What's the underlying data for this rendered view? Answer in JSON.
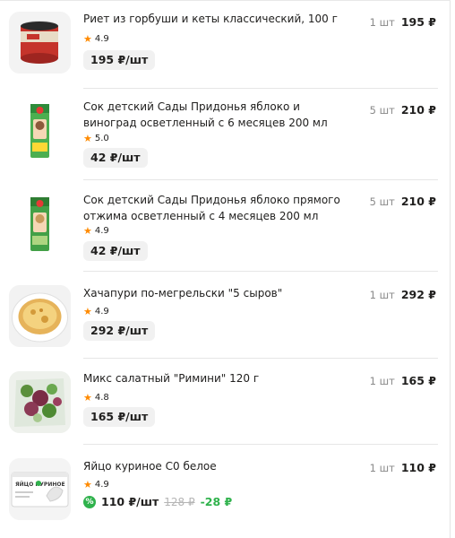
{
  "items": [
    {
      "title": "Риет из горбуши и кеты классический, 100 г",
      "rating": "4.9",
      "unit_price": "195 ₽/шт",
      "qty": "1 шт",
      "total": "195 ₽",
      "image_icon": "fish-rillette-jar"
    },
    {
      "title": "Сок детский Сады Придонья яблоко и виноград осветленный с 6 месяцев 200 мл",
      "rating": "5.0",
      "unit_price": "42 ₽/шт",
      "qty": "5 шт",
      "total": "210 ₽",
      "image_icon": "juice-box"
    },
    {
      "title": "Сок детский Сады Придонья яблоко прямого отжима осветленный с 4 месяцев 200 мл",
      "rating": "4.9",
      "unit_price": "42 ₽/шт",
      "qty": "5 шт",
      "total": "210 ₽",
      "image_icon": "juice-box"
    },
    {
      "title": "Хачапури по-мегрельски \"5 сыров\"",
      "rating": "4.9",
      "unit_price": "292 ₽/шт",
      "qty": "1 шт",
      "total": "292 ₽",
      "image_icon": "khachapuri-plate"
    },
    {
      "title": "Микс салатный \"Римини\" 120 г",
      "rating": "4.8",
      "unit_price": "165 ₽/шт",
      "qty": "1 шт",
      "total": "165 ₽",
      "image_icon": "salad-mix-bag"
    },
    {
      "title": "Яйцо куриное С0 белое",
      "rating": "4.9",
      "unit_price": "110 ₽/шт",
      "old_price": "128 ₽",
      "discount": "-28 ₽",
      "qty": "1 шт",
      "total": "110 ₽",
      "image_icon": "egg-carton",
      "image_text": "ЯЙЦО КУРИНОЕ"
    }
  ],
  "colors": {
    "star": "#ff8a00",
    "promo": "#2fb24c",
    "price_bg": "#f1f1f1"
  }
}
